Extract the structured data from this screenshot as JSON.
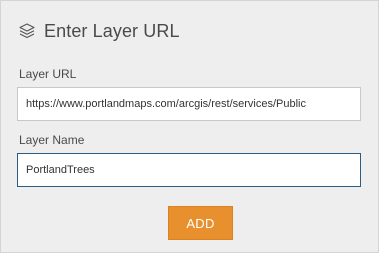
{
  "dialog": {
    "title": "Enter Layer URL",
    "icon": "layers-icon"
  },
  "layer_url": {
    "label": "Layer URL",
    "value": "https://www.portlandmaps.com/arcgis/rest/services/Public"
  },
  "layer_name": {
    "label": "Layer Name",
    "value": "PortlandTrees"
  },
  "actions": {
    "add_label": "ADD"
  },
  "colors": {
    "panel_bg": "#eeeeee",
    "accent_button": "#e8902e",
    "focus_border": "#2b5c85"
  }
}
